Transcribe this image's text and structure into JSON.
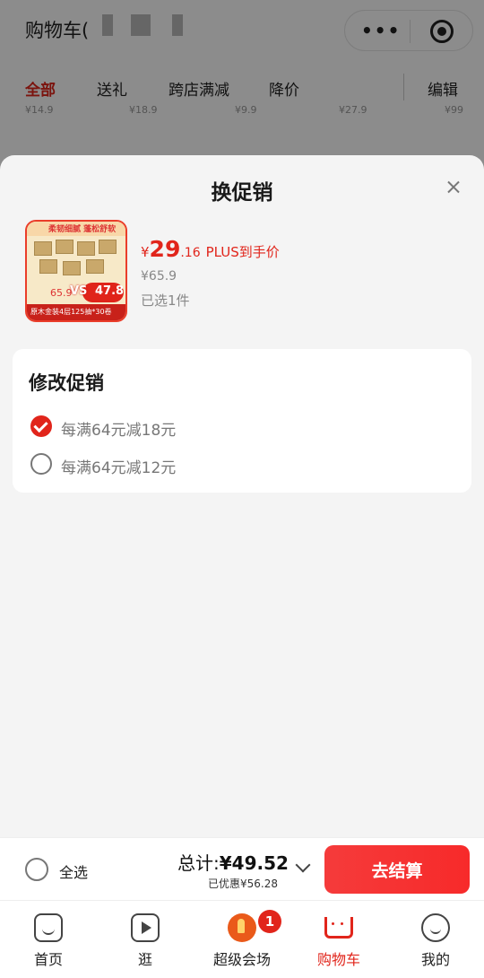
{
  "background_page": {
    "title": "购物车(",
    "tabs": [
      "全部",
      "送礼",
      "跨店满减",
      "降价",
      "编辑"
    ],
    "prices": [
      "¥14.9",
      "¥18.9",
      "¥9.9",
      "¥27.9",
      "¥99"
    ]
  },
  "sheet": {
    "title": "换促销",
    "product": {
      "thumbnail_banner": "柔韧细腻 蓬松舒软",
      "thumbnail_bottom": "原木金装4层125抽*30卷",
      "thumbnail_old_price": "65.9",
      "thumbnail_vs": "VS",
      "thumbnail_new_price": "47.8",
      "price_currency": "¥",
      "price_integer": "29",
      "price_decimal": ".16",
      "price_tag": "PLUS到手价",
      "original_price": "¥65.9",
      "selected_count": "已选1件"
    },
    "promo": {
      "heading": "修改促销",
      "options": [
        {
          "label": "每满64元减18元",
          "checked": true
        },
        {
          "label": "每满64元减12元",
          "checked": false
        }
      ]
    }
  },
  "checkout": {
    "select_all_label": "全选",
    "total_label": "总计:",
    "total_amount": "¥49.52",
    "discount_label": "已优惠¥56.28",
    "checkout_button": "去结算"
  },
  "tabbar": {
    "items": [
      {
        "label": "首页",
        "icon": "home-icon"
      },
      {
        "label": "逛",
        "icon": "video-icon"
      },
      {
        "label": "超级会场",
        "icon": "flame-icon",
        "badge": "1"
      },
      {
        "label": "购物车",
        "icon": "cart-icon",
        "active": true
      },
      {
        "label": "我的",
        "icon": "smile-icon"
      }
    ]
  },
  "colors": {
    "accent": "#e1251b",
    "checkout_button": "#f53b3b"
  }
}
